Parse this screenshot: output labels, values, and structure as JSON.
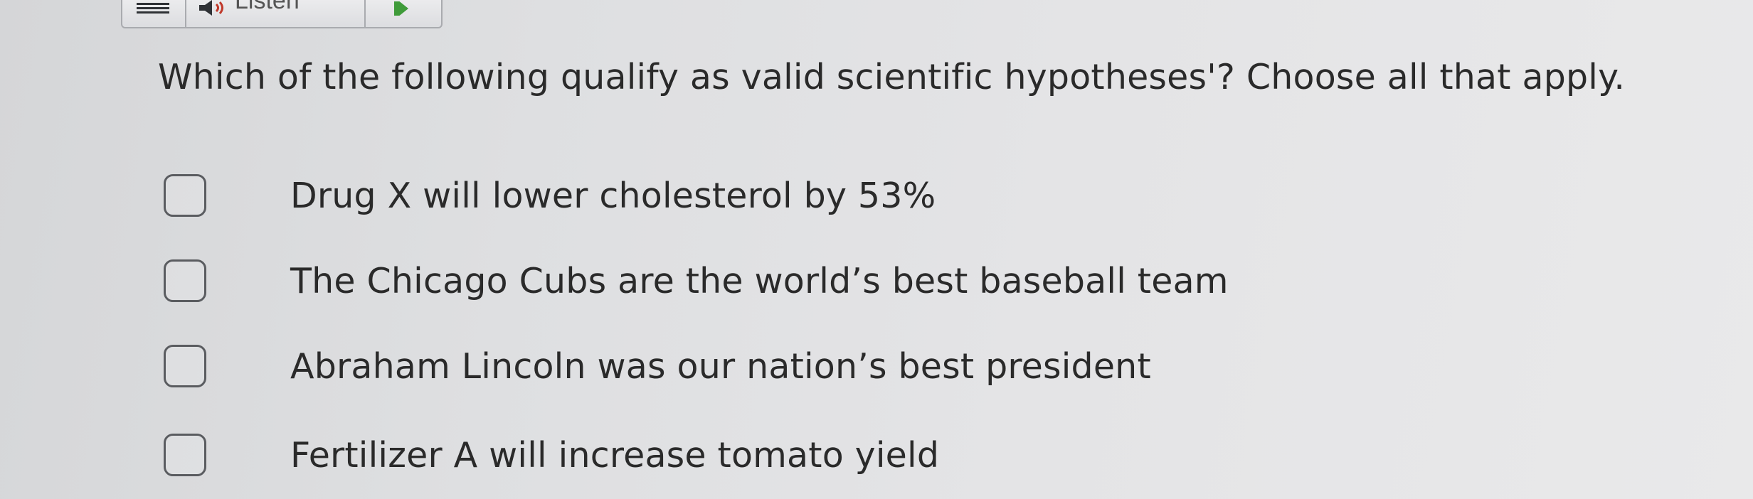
{
  "toolbar": {
    "menu_icon": "hamburger-menu-icon",
    "speaker_icon": "speaker-icon",
    "listen_label": "Listen",
    "play_icon": "play-icon",
    "play_color": "#3f9b3a"
  },
  "question": {
    "text": "Which of the following qualify as valid scientific hypotheses'? Choose all that apply."
  },
  "options": [
    {
      "label": "Drug X will lower cholesterol by 53%",
      "checked": false
    },
    {
      "label": "The Chicago Cubs are the world’s best baseball team",
      "checked": false
    },
    {
      "label": "Abraham Lincoln was our nation’s best president",
      "checked": false
    },
    {
      "label": "Fertilizer A will increase tomato yield",
      "checked": false
    }
  ]
}
